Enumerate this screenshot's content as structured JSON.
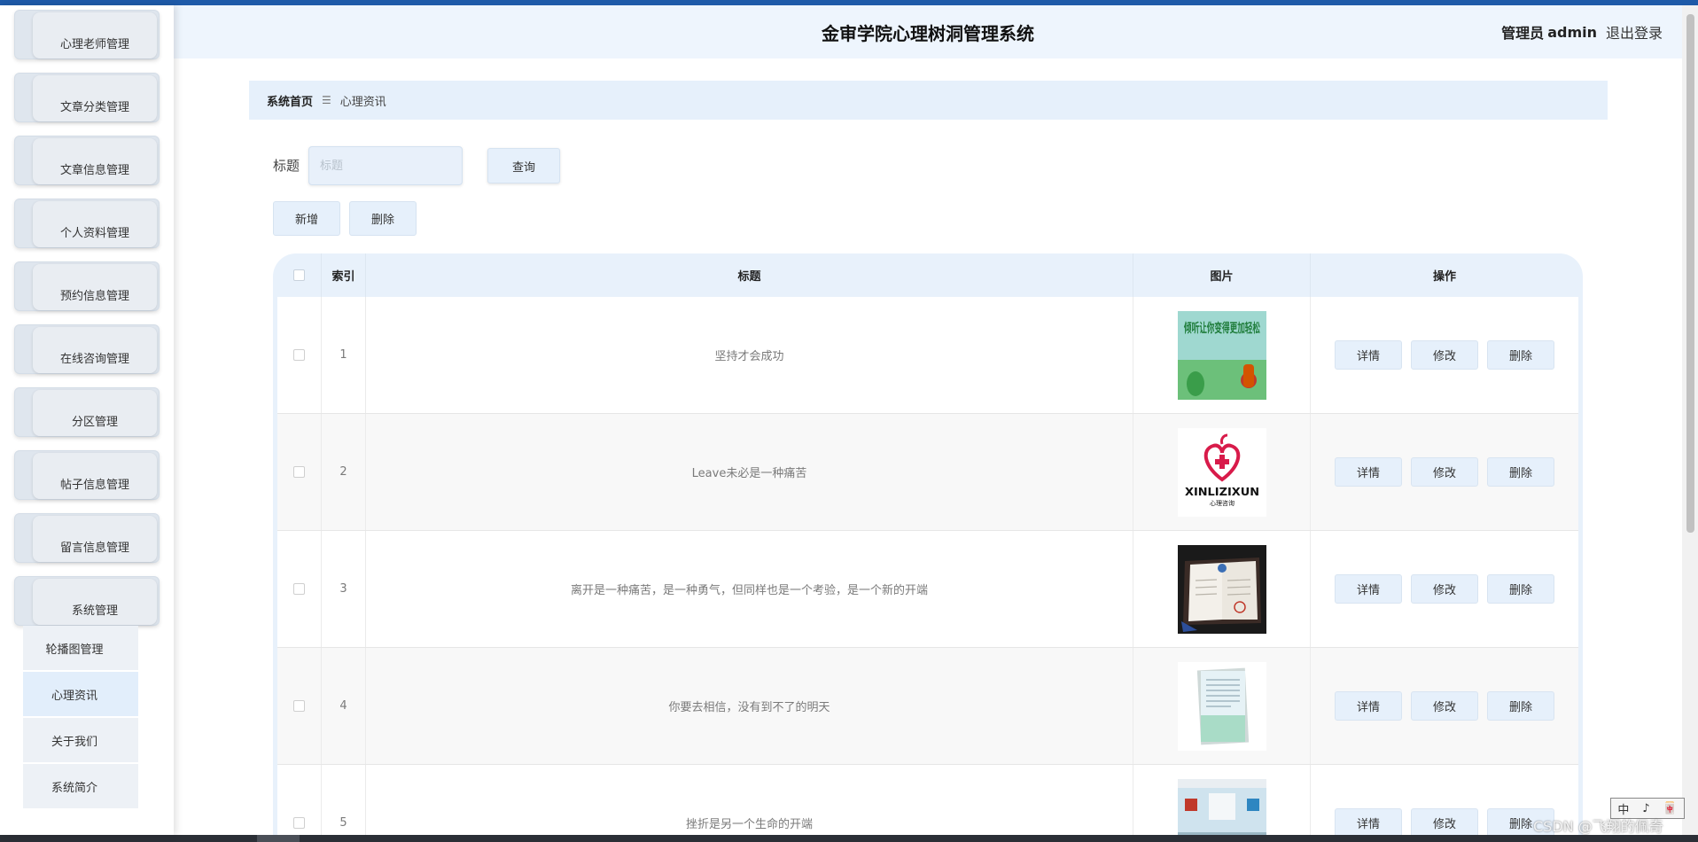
{
  "header": {
    "title": "金审学院心理树洞管理系统",
    "admin_role": "管理员",
    "admin_name": "admin",
    "logout": "退出登录"
  },
  "sidebar": {
    "items": [
      {
        "label": "心理老师管理"
      },
      {
        "label": "文章分类管理"
      },
      {
        "label": "文章信息管理"
      },
      {
        "label": "个人资料管理"
      },
      {
        "label": "预约信息管理"
      },
      {
        "label": "在线咨询管理"
      },
      {
        "label": "分区管理"
      },
      {
        "label": "帖子信息管理"
      },
      {
        "label": "留言信息管理"
      },
      {
        "label": "系统管理"
      }
    ],
    "submenu": [
      {
        "label": "轮播图管理"
      },
      {
        "label": "心理资讯",
        "active": true
      },
      {
        "label": "关于我们"
      },
      {
        "label": "系统简介"
      }
    ]
  },
  "breadcrumb": {
    "home": "系统首页",
    "separator_icon": "menu-icon",
    "current": "心理资讯"
  },
  "search": {
    "label": "标题",
    "placeholder": "标题",
    "value": "",
    "query_button": "查询"
  },
  "actions": {
    "add": "新增",
    "delete": "删除"
  },
  "table": {
    "headers": {
      "index": "索引",
      "title": "标题",
      "image": "图片",
      "ops": "操作"
    },
    "op_labels": {
      "detail": "详情",
      "edit": "修改",
      "delete": "删除"
    },
    "rows": [
      {
        "index": "1",
        "title": "坚持才会成功",
        "image": "poster-listen-image",
        "poster_text": "倾听让你变得更加轻松"
      },
      {
        "index": "2",
        "title": "Leave未必是一种痛苦",
        "image": "xinlizixun-logo-image",
        "logo_text": "XINLIZIXUN",
        "logo_sub": "心理咨询"
      },
      {
        "index": "3",
        "title": "离开是一种痛苦，是一种勇气，但同样也是一个考验，是一个新的开端",
        "image": "certificate-image"
      },
      {
        "index": "4",
        "title": "你要去相信，没有到不了的明天",
        "image": "document-image"
      },
      {
        "index": "5",
        "title": "挫折是另一个生命的开端",
        "image": "room-photo-image"
      }
    ]
  },
  "watermark": "CSDN @飞翔的佩奇",
  "ime": [
    "中",
    "♪",
    "🀄"
  ],
  "colors": {
    "accent_stripe": "#1e5aa8",
    "header_bg": "#eef5fd",
    "button_bg": "#e6f0fb"
  }
}
